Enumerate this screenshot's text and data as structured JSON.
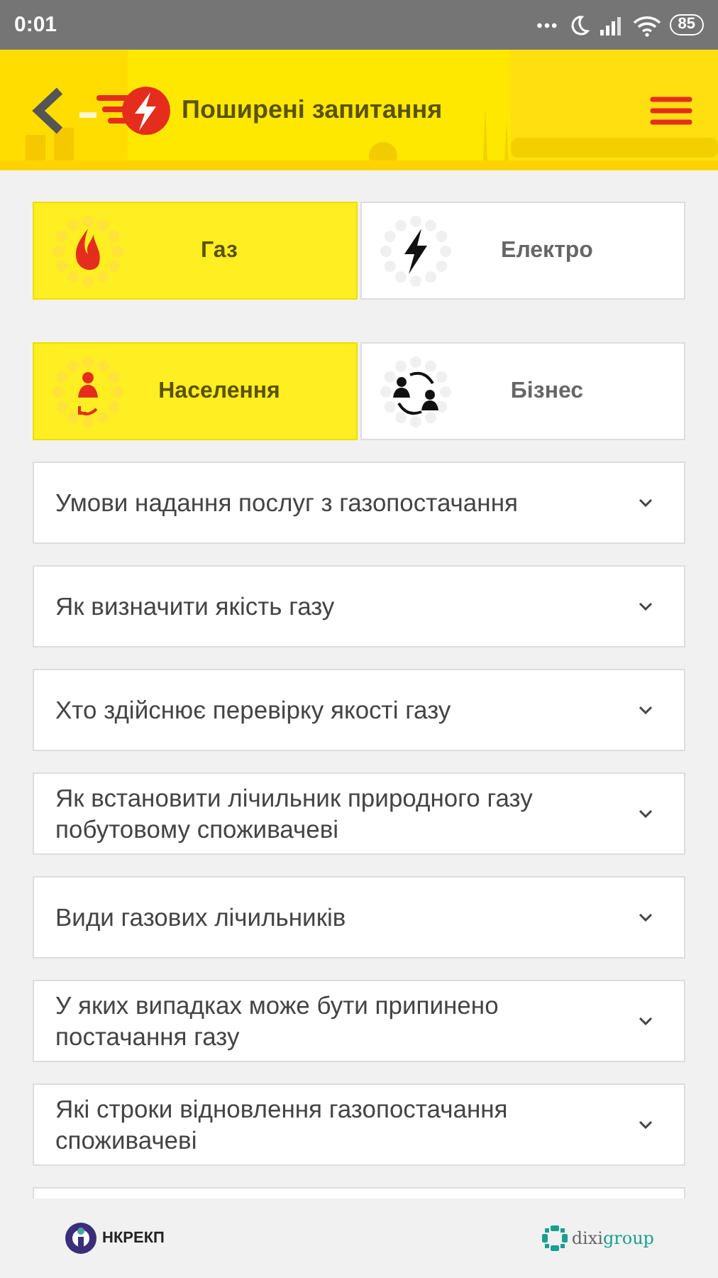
{
  "status_bar": {
    "time": "0:01",
    "dots": "•••",
    "battery": "85"
  },
  "header": {
    "title": "Поширені запитання"
  },
  "energy_tabs": [
    {
      "kind": "gas",
      "label": "Газ",
      "selected": true
    },
    {
      "kind": "power",
      "label": "Електро",
      "selected": false
    }
  ],
  "consumer_tabs": [
    {
      "kind": "person",
      "label": "Населення",
      "selected": true
    },
    {
      "kind": "business",
      "label": "Бізнес",
      "selected": false
    }
  ],
  "faq": [
    {
      "question": "Умови надання послуг з газопостачання",
      "expanded": false
    },
    {
      "question": "Як визначити якість газу",
      "expanded": false
    },
    {
      "question": "Хто здійснює перевірку якості газу",
      "expanded": false
    },
    {
      "question": "Як встановити лічильник природного газу побутовому споживачеві",
      "expanded": false
    },
    {
      "question": "Види газових лічильників",
      "expanded": false
    },
    {
      "question": "У яких випадках може бути припинено постачання газу",
      "expanded": false
    },
    {
      "question": "Які строки відновлення газопостачання споживачеві",
      "expanded": false
    }
  ],
  "footer": {
    "left_logo": "НКРЕКП",
    "right_logo": [
      "dixi",
      "group"
    ]
  }
}
